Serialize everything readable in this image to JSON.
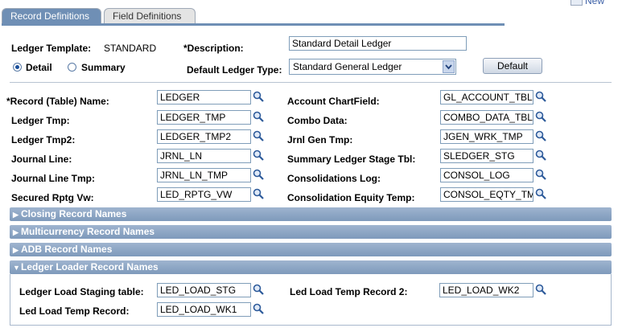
{
  "header": {
    "new_label": "New"
  },
  "tabs": [
    {
      "label": "Record Definitions"
    },
    {
      "label": "Field Definitions"
    }
  ],
  "ledger_template": {
    "label": "Ledger Template:",
    "value": "STANDARD"
  },
  "description": {
    "label": "*Description:",
    "value": "Standard Detail Ledger"
  },
  "mode": {
    "detail": "Detail",
    "summary": "Summary",
    "selected": "Detail"
  },
  "default_ledger_type": {
    "label": "Default Ledger Type:",
    "value": "Standard General Ledger"
  },
  "default_button": "Default",
  "left_fields": [
    {
      "label": "*Record (Table) Name:",
      "value": "LEDGER"
    },
    {
      "label": "Ledger Tmp:",
      "value": "LEDGER_TMP"
    },
    {
      "label": "Ledger Tmp2:",
      "value": "LEDGER_TMP2"
    },
    {
      "label": "Journal Line:",
      "value": "JRNL_LN"
    },
    {
      "label": "Journal Line Tmp:",
      "value": "JRNL_LN_TMP"
    },
    {
      "label": "Secured Rptg Vw:",
      "value": "LED_RPTG_VW"
    }
  ],
  "right_fields": [
    {
      "label": "Account ChartField:",
      "value": "GL_ACCOUNT_TBL"
    },
    {
      "label": "Combo Data:",
      "value": "COMBO_DATA_TBL"
    },
    {
      "label": "Jrnl Gen Tmp:",
      "value": "JGEN_WRK_TMP"
    },
    {
      "label": "Summary Ledger Stage Tbl:",
      "value": "SLEDGER_STG"
    },
    {
      "label": "Consolidations Log:",
      "value": "CONSOL_LOG"
    },
    {
      "label": "Consolidation Equity Temp:",
      "value": "CONSOL_EQTY_TM"
    }
  ],
  "sections": [
    {
      "label": "Closing Record Names",
      "expanded": false
    },
    {
      "label": "Multicurrency Record Names",
      "expanded": false
    },
    {
      "label": "ADB Record Names",
      "expanded": false
    },
    {
      "label": "Ledger Loader Record Names",
      "expanded": true
    }
  ],
  "loader": {
    "staging": {
      "label": "Ledger Load Staging table:",
      "value": "LED_LOAD_STG"
    },
    "temp": {
      "label": "Led Load Temp Record:",
      "value": "LED_LOAD_WK1"
    },
    "temp2": {
      "label": "Led Load Temp Record 2:",
      "value": "LED_LOAD_WK2"
    }
  },
  "colors": {
    "tab_active": "#6f8fb5",
    "section_bar": "#8aa3c4",
    "link": "#3b5fa6"
  }
}
